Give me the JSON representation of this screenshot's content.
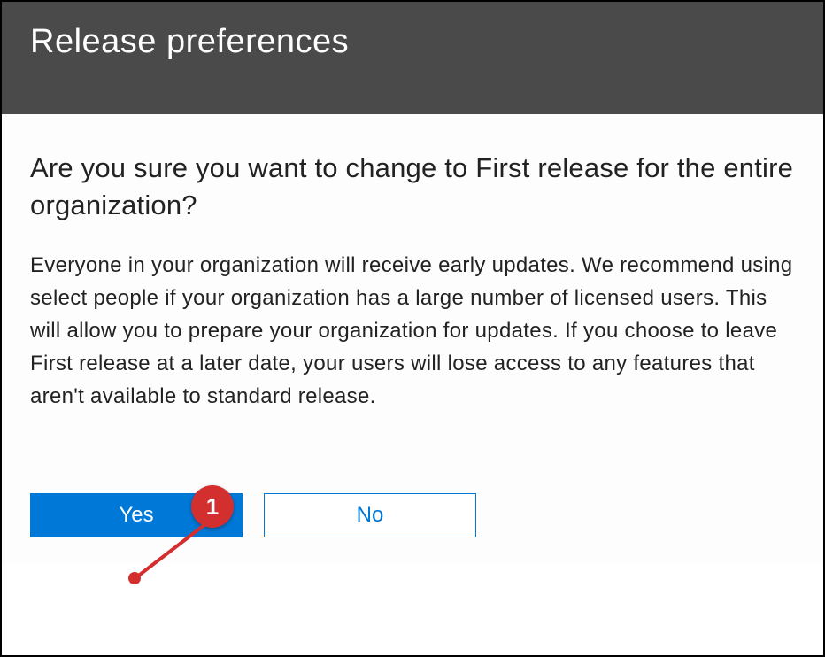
{
  "header": {
    "title": "Release preferences"
  },
  "dialog": {
    "question": "Are you sure you want to change to First release for the entire organization?",
    "description": "Everyone in your organization will receive early updates. We recommend using select people if your organization has a large number of licensed users. This will allow you to prepare your organization for updates. If you choose to leave First release at a later date, your users will lose access to any features that aren't available to standard release."
  },
  "buttons": {
    "yes_label": "Yes",
    "no_label": "No"
  },
  "annotation": {
    "badge": "1"
  }
}
